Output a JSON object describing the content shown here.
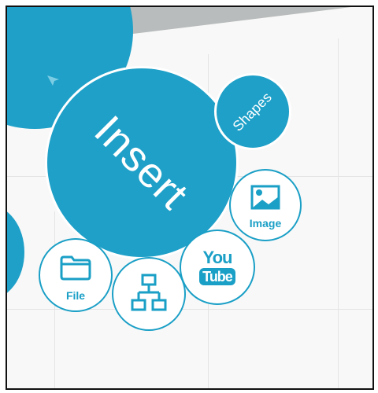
{
  "menu": {
    "insert_label": "Insert",
    "shapes_label": "Shapes",
    "image_label": "Image",
    "file_label": "File",
    "youtube_you": "You",
    "youtube_tube": "Tube"
  },
  "icons": {
    "cursor": "cursor-arrow-icon",
    "image": "image-icon",
    "file": "folder-icon",
    "diagram": "org-chart-icon",
    "youtube": "youtube-icon"
  },
  "colors": {
    "accent": "#1ea0c8",
    "outline": "#1a9fc6",
    "background": "#f8f8f8",
    "band": "#b9bcbc"
  }
}
